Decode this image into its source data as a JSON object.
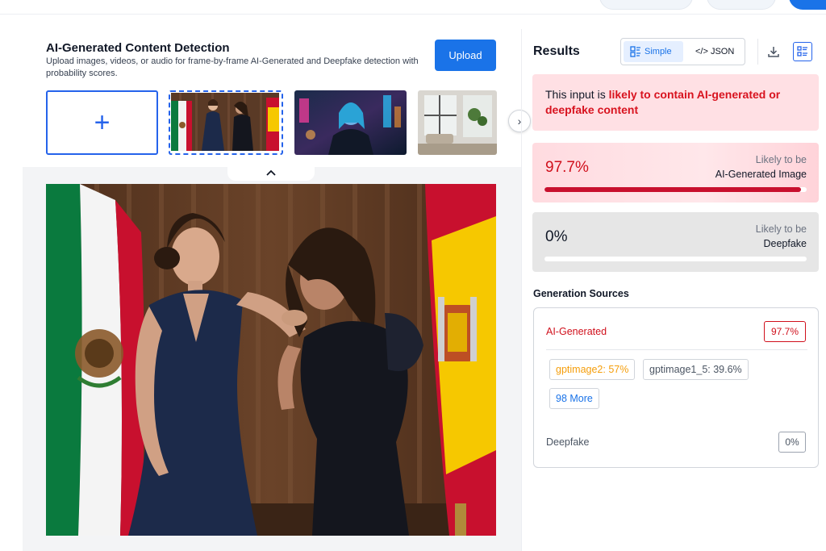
{
  "left_panel": {
    "title": "AI-Generated Content Detection",
    "subtitle": "Upload images, videos, or audio for frame-by-frame AI-Generated and Deepfake detection with probability scores.",
    "upload_label": "Upload",
    "add_tile_symbol": "+",
    "next_symbol": "›",
    "collapse_symbol": "⌃",
    "thumbnails": [
      {
        "icon": "two-women-flags-image",
        "selected": true
      },
      {
        "icon": "neon-city-portrait-image",
        "selected": false
      },
      {
        "icon": "modern-living-room-image",
        "selected": false
      }
    ]
  },
  "results": {
    "title": "Results",
    "toggle": {
      "simple_label": "Simple",
      "json_label": "</> JSON",
      "active": "simple"
    },
    "verdict": {
      "prefix": "This input is ",
      "highlight": "likely to contain AI-generated or deepfake content"
    },
    "ai_card": {
      "percent": "97.7%",
      "likely_label": "Likely to be",
      "type_label": "AI-Generated Image",
      "fill_fraction": 0.977,
      "color": "#c8102e"
    },
    "deepfake_card": {
      "percent": "0%",
      "likely_label": "Likely to be",
      "type_label": "Deepfake",
      "fill_fraction": 0.0
    }
  },
  "generation_sources": {
    "title": "Generation Sources",
    "ai_label": "AI-Generated",
    "ai_badge": "97.7%",
    "chips": [
      "gptimage2: 57%",
      "gptimage1_5: 39.6%"
    ],
    "more_label": "98 More",
    "deepfake_label": "Deepfake",
    "deepfake_badge": "0%"
  },
  "colors": {
    "accent": "#1a73e8",
    "danger": "#d0101c",
    "verdict_bg": "#ffe0e4"
  }
}
